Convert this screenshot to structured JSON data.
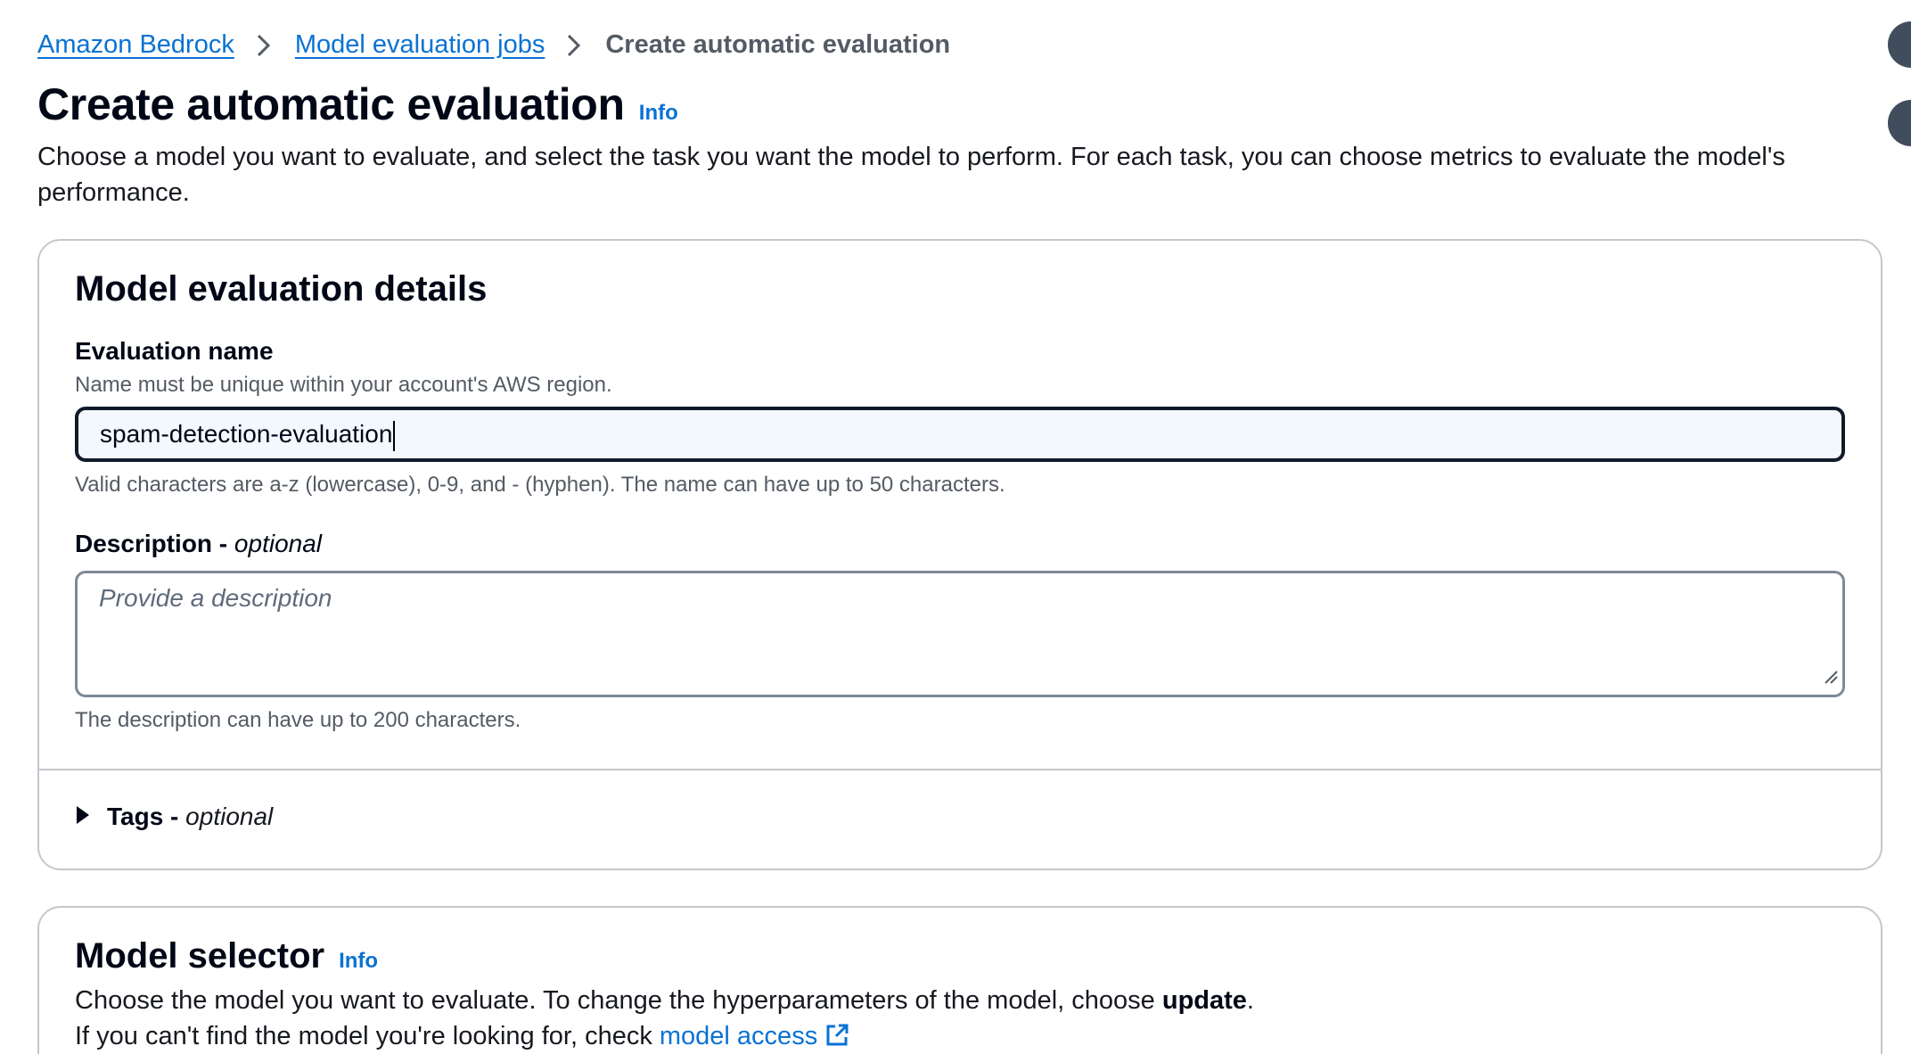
{
  "breadcrumb": {
    "items": [
      "Amazon Bedrock",
      "Model evaluation jobs"
    ],
    "current": "Create automatic evaluation"
  },
  "header": {
    "title": "Create automatic evaluation",
    "info": "Info",
    "description": "Choose a model you want to evaluate, and select the task you want the model to perform. For each task, you can choose metrics to evaluate the model's performance."
  },
  "details": {
    "heading": "Model evaluation details",
    "name_label": "Evaluation name",
    "name_hint": "Name must be unique within your account's AWS region.",
    "name_value": "spam-detection-evaluation",
    "name_constraint": "Valid characters are a-z (lowercase), 0-9, and - (hyphen). The name can have up to 50 characters.",
    "desc_label": "Description -",
    "desc_optional": "optional",
    "desc_placeholder": "Provide a description",
    "desc_constraint": "The description can have up to 200 characters.",
    "tags_label": "Tags -",
    "tags_optional": "optional"
  },
  "selector": {
    "heading": "Model selector",
    "info": "Info",
    "line1_prefix": "Choose the model you want to evaluate. To change the hyperparameters of the model, choose",
    "line1_bold": "update",
    "line1_suffix": ".",
    "line2_prefix": "If you can't find the model you're looking for, check",
    "line2_link": "model access"
  },
  "colors": {
    "link": "#0972d3",
    "input_focus_border": "#0f1b2a",
    "input_focus_bg": "#f2f8fd",
    "card_border": "#c6c6cd"
  },
  "icons": {
    "breadcrumb_separator": "chevron-right-icon",
    "tags_toggle": "caret-right-icon",
    "external_link": "external-link-icon",
    "textarea_resize": "resize-handle-icon"
  }
}
